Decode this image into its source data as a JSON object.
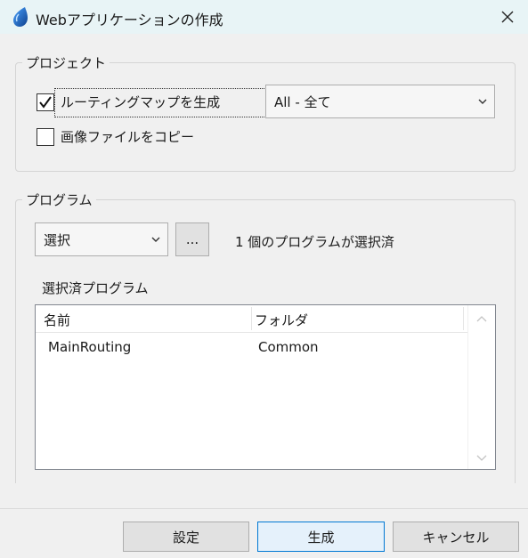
{
  "window": {
    "title": "Webアプリケーションの作成",
    "icon": "water-drop-icon",
    "close_icon": "close-icon"
  },
  "project_group": {
    "legend": "プロジェクト",
    "routing_map": {
      "label": "ルーティングマップを生成",
      "checked": true
    },
    "copy_images": {
      "label": "画像ファイルをコピー",
      "checked": false
    },
    "scope_select": {
      "value": "All - 全て"
    }
  },
  "program_group": {
    "legend": "プログラム",
    "mode_select": {
      "value": "選択"
    },
    "browse_button": "...",
    "selected_count_text": "1 個のプログラムが選択済",
    "selected_label": "選択済プログラム",
    "table": {
      "columns": [
        "名前",
        "フォルダ"
      ],
      "rows": [
        [
          "MainRouting",
          "Common"
        ]
      ]
    }
  },
  "footer": {
    "settings_button": "設定",
    "generate_button": "生成",
    "cancel_button": "キャンセル"
  },
  "colors": {
    "titlebar": "#e8f4f6",
    "focus_border": "#0078d4",
    "icon_blue": "#1565c0"
  }
}
